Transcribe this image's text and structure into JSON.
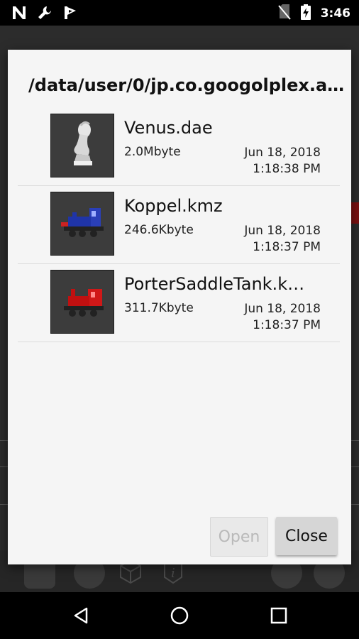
{
  "status_bar": {
    "time": "3:46",
    "icons": [
      "notification-n-icon",
      "wrench-icon",
      "flag-icon",
      "no-sim-icon",
      "battery-charging-icon"
    ]
  },
  "dialog": {
    "title": "/data/user/0/jp.co.googolplex.a…",
    "files": [
      {
        "name": "Venus.dae",
        "size": "2.0Mbyte",
        "date": "Jun 18, 2018",
        "time": "1:18:38 PM",
        "thumbnail": "venus-bust-thumbnail"
      },
      {
        "name": "Koppel.kmz",
        "size": "246.6Kbyte",
        "date": "Jun 18, 2018",
        "time": "1:18:37 PM",
        "thumbnail": "blue-locomotive-thumbnail"
      },
      {
        "name": "PorterSaddleTank.k…",
        "size": "311.7Kbyte",
        "date": "Jun 18, 2018",
        "time": "1:18:37 PM",
        "thumbnail": "red-locomotive-thumbnail"
      }
    ],
    "open_label": "Open",
    "close_label": "Close",
    "open_enabled": false
  },
  "nav_bar": {
    "buttons": [
      "back-icon",
      "home-icon",
      "recents-icon"
    ]
  },
  "colors": {
    "dialog_bg": "#f5f5f5",
    "thumb_bg": "#3c3c3c",
    "status_bar_bg": "#000000",
    "disabled_text": "#b9b9b9"
  }
}
